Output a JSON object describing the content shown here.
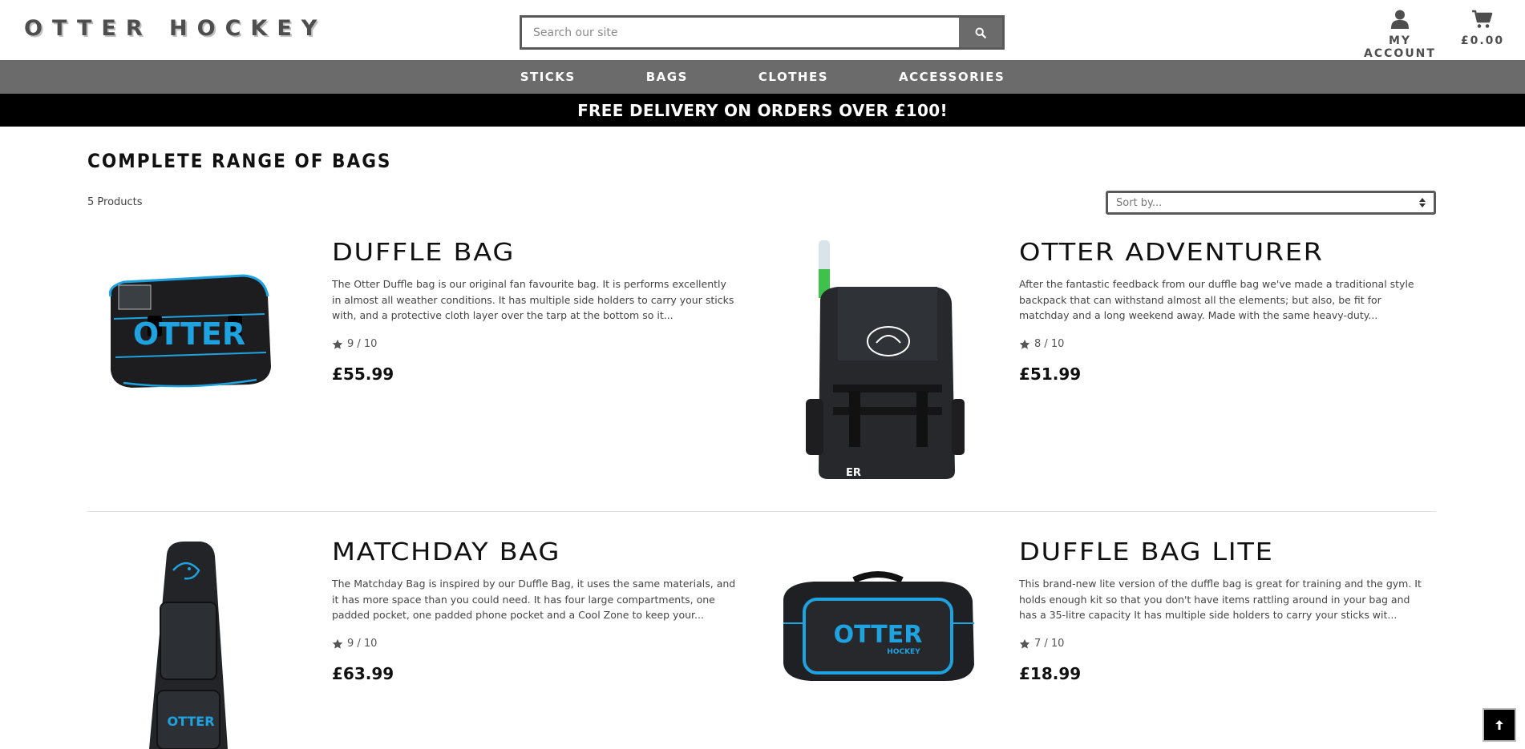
{
  "header": {
    "logo_text": "OTTER HOCKEY",
    "search_placeholder": "Search our site",
    "account_label": "MY ACCOUNT",
    "cart_total": "£0.00"
  },
  "nav": {
    "items": [
      {
        "label": "STICKS"
      },
      {
        "label": "BAGS"
      },
      {
        "label": "CLOTHES"
      },
      {
        "label": "ACCESSORIES"
      }
    ]
  },
  "promo": {
    "text": "FREE DELIVERY ON ORDERS OVER £100!"
  },
  "page": {
    "title": "COMPLETE RANGE OF BAGS",
    "count": "5 Products",
    "sort_placeholder": "Sort by..."
  },
  "products": [
    {
      "name": "DUFFLE BAG",
      "description": "The Otter Duffle bag is our original fan favourite bag. It is performs excellently in almost all weather conditions. It has multiple side holders to carry your sticks with, and a protective cloth layer over the tarp at the bottom so it...",
      "rating": "9 / 10",
      "price": "£55.99",
      "image_text": "OTTER"
    },
    {
      "name": "OTTER ADVENTURER",
      "description": "After the fantastic feedback from our duffle bag we've made a traditional style backpack that can withstand almost all the elements; but also, be fit for matchday and a long weekend away. Made with the same heavy-duty...",
      "rating": "8 / 10",
      "price": "£51.99",
      "image_text": "ER"
    },
    {
      "name": "MATCHDAY BAG",
      "description": "The Matchday Bag is inspired by our Duffle Bag, it uses the same materials, and it has more space than you could need. It has four large compartments, one padded pocket, one padded phone pocket and a Cool Zone to keep your...",
      "rating": "9 / 10",
      "price": "£63.99",
      "image_text": "OTTER"
    },
    {
      "name": "DUFFLE BAG LITE",
      "description": "This brand-new lite version of the duffle bag is great for training and the gym. It holds enough kit so that you don't have items rattling around in your bag and has a 35-litre capacity It has multiple side holders to carry your sticks wit...",
      "rating": "7 / 10",
      "price": "£18.99",
      "image_text": "OTTER",
      "image_subtext": "HOCKEY"
    }
  ],
  "colors": {
    "nav_bg": "#6b6b6b",
    "promo_bg": "#000000",
    "accent_blue": "#1fa3e0"
  }
}
